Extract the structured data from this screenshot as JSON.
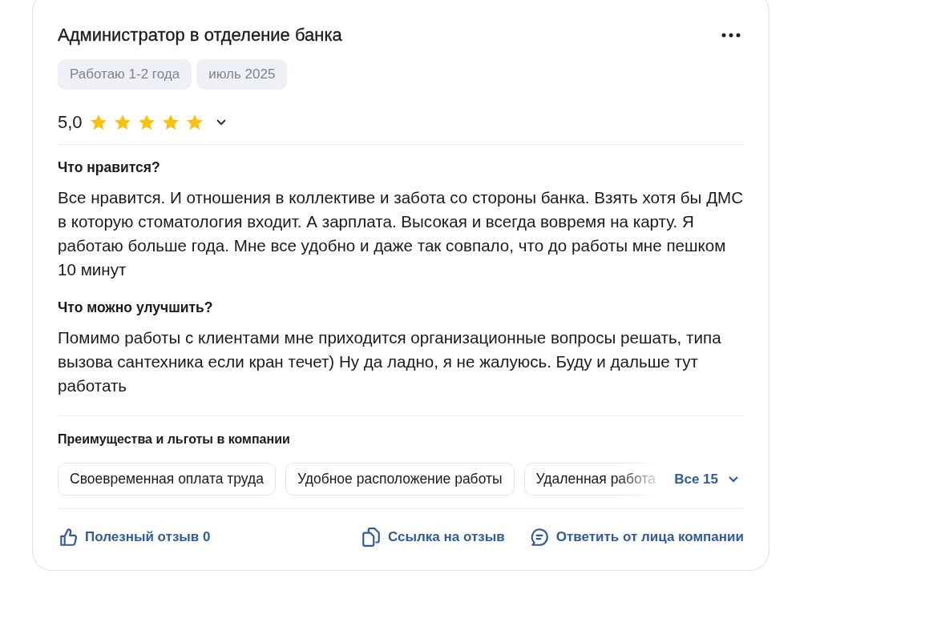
{
  "review": {
    "title": "Администратор в отделение банка",
    "tags": [
      "Работаю 1-2 года",
      "июль 2025"
    ],
    "rating": {
      "value": "5,0",
      "stars": 5,
      "expanded": false
    },
    "sections": [
      {
        "heading": "Что нравится?",
        "text": "Все нравится. И отношения в коллективе и забота со стороны банка. Взять хотя бы ДМС в которую стоматология входит. А зарплата. Высокая и всегда вовремя на карту. Я работаю больше года. Мне все удобно и даже так совпало, что до работы мне пешком 10 минут"
      },
      {
        "heading": "Что можно улучшить?",
        "text": "Помимо работы с клиентами мне приходится организационные вопросы решать, типа вызова сантехника если кран течет) Ну да ладно, я не жалуюсь. Буду и дальше тут работать"
      }
    ],
    "benefits": {
      "heading": "Преимущества и льготы в компании",
      "items": [
        "Своевременная оплата труда",
        "Удобное расположение работы",
        "Удаленная работа"
      ],
      "more": "Все 15"
    },
    "actions": [
      {
        "kind": "like",
        "label": "Полезный отзыв 0"
      },
      {
        "kind": "copy",
        "label": "Ссылка на отзыв"
      },
      {
        "kind": "reply",
        "label": "Ответить от лица компании"
      }
    ]
  }
}
